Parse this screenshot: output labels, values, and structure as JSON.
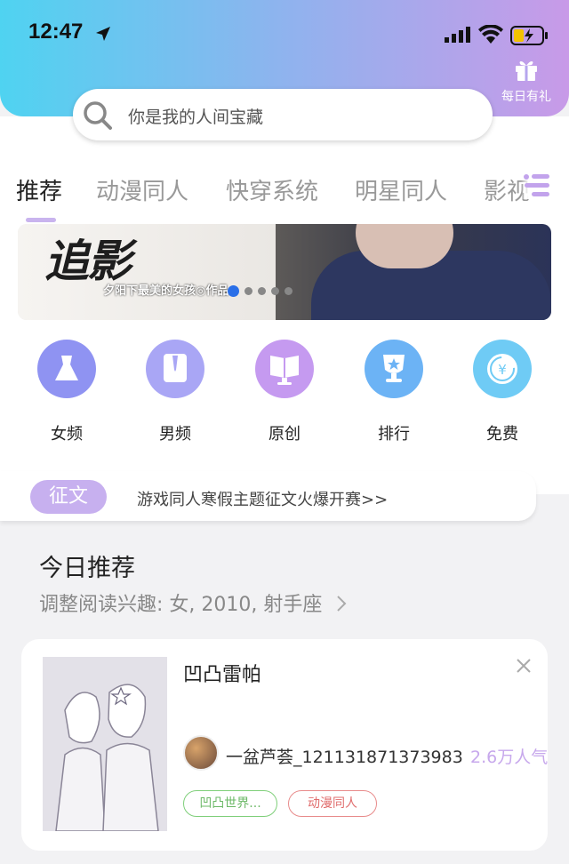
{
  "status_bar": {
    "time": "12:47"
  },
  "gift": {
    "label": "每日有礼"
  },
  "search": {
    "placeholder": "你是我的人间宝藏"
  },
  "tabs": [
    {
      "label": "推荐",
      "active": true
    },
    {
      "label": "动漫同人"
    },
    {
      "label": "快穿系统"
    },
    {
      "label": "明星同人"
    },
    {
      "label": "影视"
    }
  ],
  "banner": {
    "title": "追影",
    "subtitle": "夕阳下最美的女孩◎作品",
    "slide_count": 5,
    "active_slide": 1
  },
  "categories": [
    {
      "label": "女频",
      "icon": "dress-icon",
      "color": "#8f93f2"
    },
    {
      "label": "男频",
      "icon": "shirt-icon",
      "color": "#a9a6f5"
    },
    {
      "label": "原创",
      "icon": "book-icon",
      "color": "#c59af0"
    },
    {
      "label": "排行",
      "icon": "trophy-icon",
      "color": "#6cb3f5"
    },
    {
      "label": "免费",
      "icon": "yen-icon",
      "color": "#6fcbf5"
    }
  ],
  "notice": {
    "badge": "征文",
    "text": "游戏同人寒假主题征文火爆开赛>>"
  },
  "section": {
    "title": "今日推荐",
    "subtitle": "调整阅读兴趣: 女, 2010, 射手座"
  },
  "book": {
    "title": "凹凸雷帕",
    "author": "一盆芦荟_121131871373983",
    "popularity": "2.6万人气",
    "tags": [
      "凹凸世界...",
      "动漫同人"
    ]
  },
  "colors": {
    "accent": "#c7b0ef",
    "header_from": "#4fd3f1",
    "header_to": "#c89ae8"
  }
}
